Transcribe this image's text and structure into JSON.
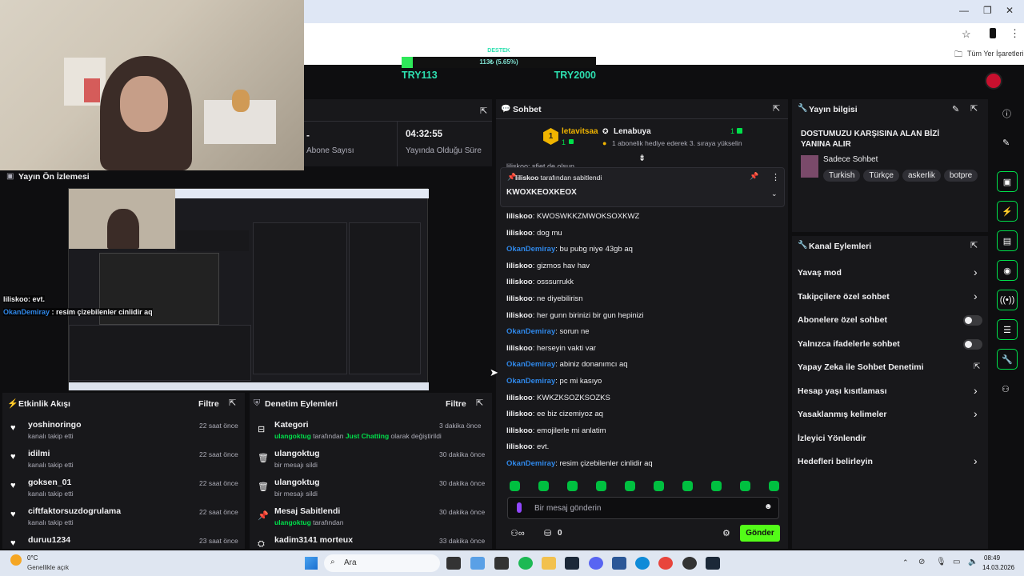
{
  "browser": {
    "bookmarks_label": "Tüm Yer İşaretleri",
    "win_min": "—",
    "win_max": "❐",
    "win_close": "✕"
  },
  "goal": {
    "title": "DESTEK",
    "progress_text": "113₺ (5.65%)",
    "current": "TRY113",
    "target": "TRY2000",
    "progress": 0.0565
  },
  "stats": {
    "left_value": "-",
    "left_label": "Abone Sayısı",
    "right_value": "04:32:55",
    "right_label": "Yayında Olduğu Süre"
  },
  "preview": {
    "title": "Yayın Ön İzlemesi",
    "overlay_lines": [
      {
        "user": "liliskoo",
        "text": ": evt."
      },
      {
        "user": "OkanDemiray",
        "text": " : resim çizebilenler cinlidir aq"
      }
    ]
  },
  "activity": {
    "title": "Etkinlik Akışı",
    "filter": "Filtre",
    "items": [
      {
        "name": "yoshinoringo",
        "sub": "kanalı takip etti",
        "time": "22 saat önce"
      },
      {
        "name": "idilmi",
        "sub": "kanalı takip etti",
        "time": "22 saat önce"
      },
      {
        "name": "goksen_01",
        "sub": "kanalı takip etti",
        "time": "22 saat önce"
      },
      {
        "name": "ciftfaktorsuzdogrulama",
        "sub": "kanalı takip etti",
        "time": "22 saat önce"
      },
      {
        "name": "duruu1234",
        "sub": "",
        "time": "23 saat önce"
      }
    ]
  },
  "moderation": {
    "title": "Denetim Eylemleri",
    "filter": "Filtre",
    "items": [
      {
        "title": "Kategori",
        "actor": "ulangoktug",
        "mid": " tarafından ",
        "extra": "Just Chatting",
        "tail": " olarak değiştirildi",
        "time": "3 dakika önce"
      },
      {
        "title": "ulangoktug",
        "actor": "",
        "mid": "bir mesajı sildi",
        "extra": "",
        "tail": "",
        "time": "30 dakika önce"
      },
      {
        "title": "ulangoktug",
        "actor": "",
        "mid": "bir mesajı sildi",
        "extra": "",
        "tail": "",
        "time": "30 dakika önce"
      },
      {
        "title": "Mesaj Sabitlendi",
        "actor": "ulangoktug",
        "mid": " tarafından",
        "extra": "",
        "tail": "",
        "time": "30 dakika önce"
      },
      {
        "title": "kadim3141  morteux",
        "actor": "",
        "mid": "",
        "extra": "",
        "tail": "",
        "time": "33 dakika önce"
      }
    ]
  },
  "chat": {
    "title": "Sohbet",
    "gift_left_user": "letavitsaa",
    "gift_left_count": "1",
    "gift_badge": "1",
    "gift_right_user": "Lenabuya",
    "gift_right_count": "1",
    "gift_text": "1 abonelik hediye ederek 3. sıraya yükselin",
    "partial_line": "liliskoo: sfiet de olsun",
    "pinned_by_user": "liliskoo",
    "pinned_by_text": " tarafından sabitlendi",
    "pinned_message": "KWOXKEOXKEOX",
    "messages": [
      {
        "user": "liliskoo",
        "text": ": KWOSWKKZMWOKSOXKWZ",
        "color": "white"
      },
      {
        "user": "liliskoo",
        "text": ": dog mu",
        "color": "white"
      },
      {
        "user": "OkanDemiray",
        "text": ": bu pubg niye 43gb aq",
        "color": "blue"
      },
      {
        "user": "liliskoo",
        "text": ": gizmos hav hav",
        "color": "white"
      },
      {
        "user": "liliskoo",
        "text": ": osssurrukk",
        "color": "white"
      },
      {
        "user": "liliskoo",
        "text": ": ne diyebilirisn",
        "color": "white"
      },
      {
        "user": "liliskoo",
        "text": ": her gunn birinizi bir gun hepinizi",
        "color": "white"
      },
      {
        "user": "OkanDemiray",
        "text": ": sorun ne",
        "color": "blue"
      },
      {
        "user": "liliskoo",
        "text": ": herseyin vakti var",
        "color": "white"
      },
      {
        "user": "OkanDemiray",
        "text": ": abiniz donanımcı aq",
        "color": "blue"
      },
      {
        "user": "OkanDemiray",
        "text": ": pc mi kasıyo",
        "color": "blue"
      },
      {
        "user": "liliskoo",
        "text": ": KWKZKSOZKSOZKS",
        "color": "white"
      },
      {
        "user": "liliskoo",
        "text": ": ee biz cizemiyoz aq",
        "color": "white"
      },
      {
        "user": "liliskoo",
        "text": ": emojilerle mi anlatim",
        "color": "white"
      },
      {
        "user": "liliskoo",
        "text": ": evt.",
        "color": "white"
      },
      {
        "user": "OkanDemiray",
        "text": ": resim çizebilenler cinlidir aq",
        "color": "blue"
      }
    ],
    "input_placeholder": "Bir mesaj gönderin",
    "points": "0",
    "send": "Gönder"
  },
  "stream_info": {
    "title": "Yayın bilgisi",
    "stream_title": "DOSTUMUZU KARŞISINA ALAN BİZİ YANINA ALIR",
    "category": "Sadece Sohbet",
    "tags": [
      "Turkish",
      "Türkçe",
      "askerlik",
      "botpre"
    ]
  },
  "channel_actions": {
    "title": "Kanal Eylemleri",
    "items": [
      {
        "label": "Yavaş mod",
        "control": "chevron"
      },
      {
        "label": "Takipçilere özel sohbet",
        "control": "chevron"
      },
      {
        "label": "Abonelere özel sohbet",
        "control": "toggle"
      },
      {
        "label": "Yalnızca ifadelerle sohbet",
        "control": "toggle"
      },
      {
        "label": "Yapay Zeka ile Sohbet Denetimi",
        "control": "external"
      },
      {
        "label": "Hesap yaşı kısıtlaması",
        "control": "chevron"
      },
      {
        "label": "Yasaklanmış kelimeler",
        "control": "chevron"
      },
      {
        "label": "İzleyici Yönlendir",
        "control": "none"
      },
      {
        "label": "Hedefleri belirleyin",
        "control": "chevron"
      }
    ]
  },
  "taskbar": {
    "weather_temp": "0°C",
    "weather_desc": "Genellikle açık",
    "search_placeholder": "Ara",
    "time": "08:49",
    "date": "14.03.2026"
  },
  "colors": {
    "accent": "#00e04b",
    "bg": "#0e0e10",
    "panel": "#18181b",
    "blue_user": "#2f87e8"
  }
}
